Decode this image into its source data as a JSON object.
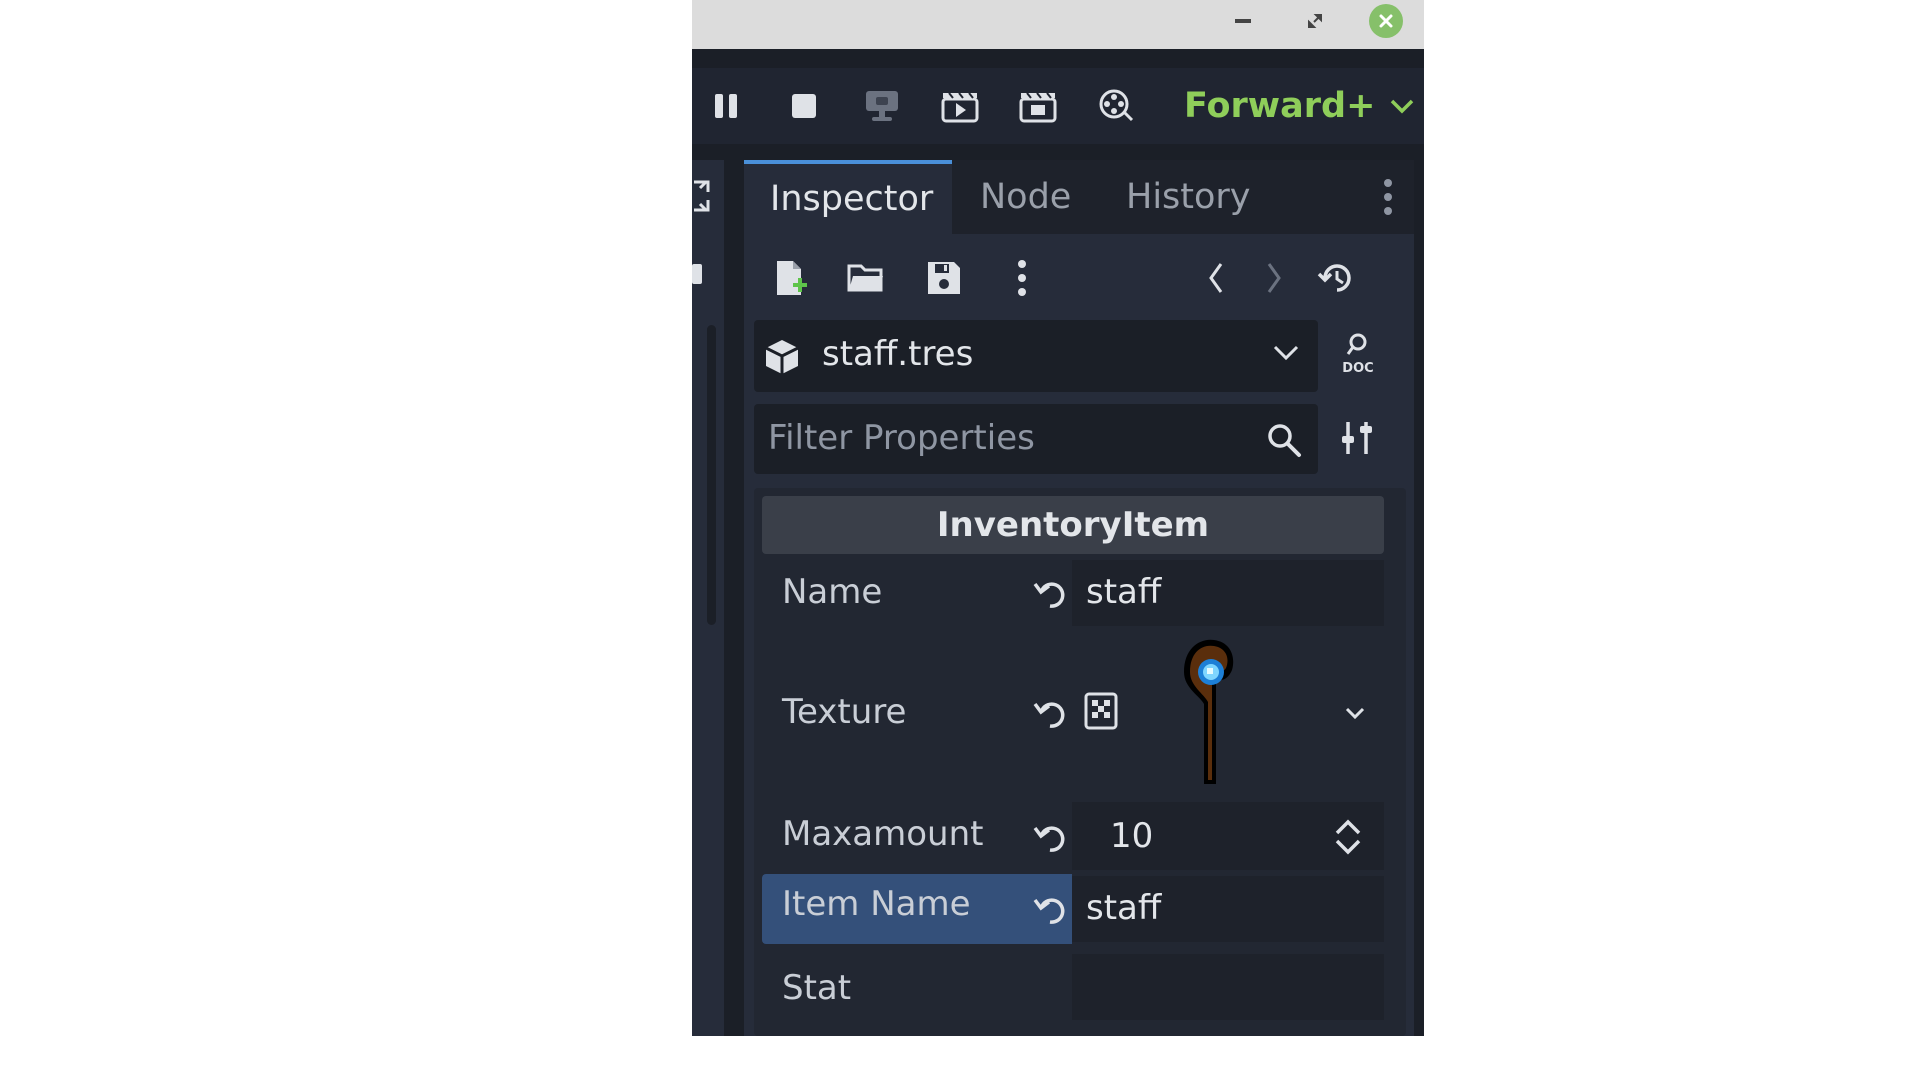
{
  "toolbar": {
    "icons": [
      "pause-icon",
      "stop-icon",
      "remote-debug-icon",
      "play-scene-icon",
      "play-custom-scene-icon",
      "movie-maker-icon"
    ],
    "renderer_label": "Forward+"
  },
  "dock": {
    "tabs": [
      {
        "label": "Inspector",
        "active": true
      },
      {
        "label": "Node",
        "active": false
      },
      {
        "label": "History",
        "active": false
      }
    ]
  },
  "inspector": {
    "resource_name": "staff.tres",
    "filter_placeholder": "Filter Properties",
    "category": "InventoryItem",
    "properties": {
      "name": {
        "label": "Name",
        "value": "staff"
      },
      "texture": {
        "label": "Texture",
        "preview": "staff sprite"
      },
      "maxamount": {
        "label": "Maxamount",
        "value": "10"
      },
      "item_name": {
        "label": "Item Name",
        "value": "staff"
      },
      "stat": {
        "label": "Stat",
        "value": ""
      }
    }
  },
  "colors": {
    "accent": "#4a90d9",
    "renderer": "#8fce5a",
    "close_button": "#86c06a",
    "selected_row": "#34507a"
  }
}
